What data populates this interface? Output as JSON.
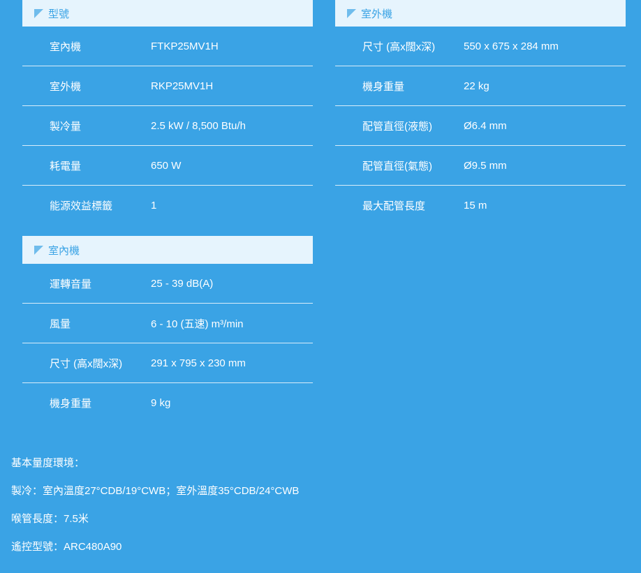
{
  "sections": {
    "model": {
      "title": "型號",
      "rows": [
        {
          "key": "室內機",
          "value": "FTKP25MV1H"
        },
        {
          "key": "室外機",
          "value": "RKP25MV1H"
        },
        {
          "key": "製冷量",
          "value": "2.5 kW / 8,500 Btu/h"
        },
        {
          "key": "耗電量",
          "value": "650 W"
        },
        {
          "key": "能源效益標籤",
          "value": "1"
        }
      ]
    },
    "outdoor": {
      "title": "室外機",
      "rows": [
        {
          "key": "尺寸 (高x闊x深)",
          "value": "550 x 675 x 284 mm"
        },
        {
          "key": "機身重量",
          "value": "22 kg"
        },
        {
          "key": "配管直徑(液態)",
          "value": "Ø6.4 mm"
        },
        {
          "key": "配管直徑(氣態)",
          "value": "Ø9.5 mm"
        },
        {
          "key": "最大配管長度",
          "value": "15 m"
        }
      ]
    },
    "indoor": {
      "title": "室內機",
      "rows": [
        {
          "key": "運轉音量",
          "value": "25 - 39 dB(A)"
        },
        {
          "key": "風量",
          "value": "6 - 10 (五速) m³/min"
        },
        {
          "key": "尺寸 (高x闊x深)",
          "value": "291 x 795 x 230 mm"
        },
        {
          "key": "機身重量",
          "value": "9 kg"
        }
      ]
    }
  },
  "notes": [
    "基本量度環境：",
    "製冷：室內溫度27°CDB/19°CWB；室外溫度35°CDB/24°CWB",
    "喉管長度：7.5米",
    "遙控型號：ARC480A90"
  ],
  "colors": {
    "background": "#3aa3e5",
    "header_bg": "#e6f4fd",
    "header_text": "#3aa3e5",
    "divider": "#d9edfa"
  }
}
